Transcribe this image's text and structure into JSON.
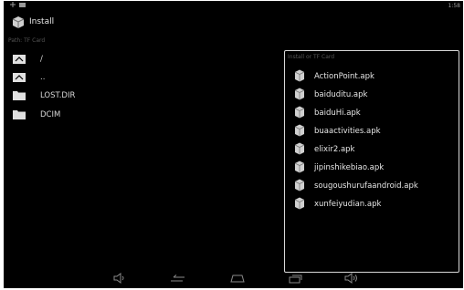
{
  "statusbar": {
    "left_icons": [
      "usb-icon",
      "notification-icon"
    ],
    "right_text": "1:58"
  },
  "actionbar": {
    "title": "Install",
    "icon": "package-icon"
  },
  "path_label": "Path: TF Card",
  "files": [
    {
      "label": "/",
      "icon": "folder-up-icon"
    },
    {
      "label": "..",
      "icon": "folder-up-icon"
    },
    {
      "label": "LOST.DIR",
      "icon": "folder-icon"
    },
    {
      "label": "DCIM",
      "icon": "folder-icon"
    }
  ],
  "apk_panel": {
    "title": "Install or TF Card",
    "items": [
      {
        "label": "ActionPoint.apk",
        "icon": "apk-icon"
      },
      {
        "label": "baiduditu.apk",
        "icon": "apk-icon"
      },
      {
        "label": "baiduHi.apk",
        "icon": "apk-icon"
      },
      {
        "label": "buaactivities.apk",
        "icon": "apk-icon"
      },
      {
        "label": "elixir2.apk",
        "icon": "apk-icon"
      },
      {
        "label": "jipinshikebiao.apk",
        "icon": "apk-icon"
      },
      {
        "label": "sougoushurufaandroid.apk",
        "icon": "apk-icon"
      },
      {
        "label": "xunfeiyudian.apk",
        "icon": "apk-icon"
      }
    ]
  },
  "navbar": [
    "volume-down-icon",
    "back-icon",
    "home-icon",
    "recent-apps-icon",
    "volume-up-icon"
  ],
  "colors": {
    "background": "#000000",
    "text": "#e6e6e6",
    "panel_border": "#d8d8d8",
    "dim_text": "#555555"
  }
}
